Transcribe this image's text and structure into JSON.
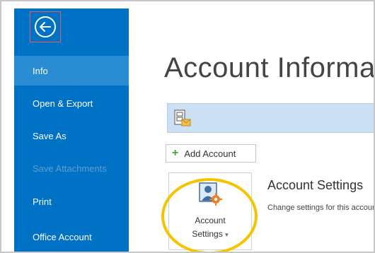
{
  "sidebar": {
    "items": [
      {
        "label": "Info"
      },
      {
        "label": "Open & Export"
      },
      {
        "label": "Save As"
      },
      {
        "label": "Save Attachments"
      },
      {
        "label": "Print"
      },
      {
        "label": "Office Account"
      }
    ],
    "selected": "Info",
    "back_icon": "back-arrow-icon"
  },
  "main": {
    "title": "Account Information",
    "account_bar_icon": "email-account-icon",
    "add_account_label": "Add Account",
    "settings_tile": {
      "icon": "account-settings-icon",
      "line1": "Account",
      "line2": "Settings",
      "dropdown_glyph": "▾"
    },
    "section_title": "Account Settings",
    "section_desc": "Change settings for this account"
  },
  "colors": {
    "sidebar": "#0072c6",
    "sidebar_selected": "#2a8dd4",
    "highlight_ring": "#f5c400",
    "account_bar": "#cce0f4"
  }
}
